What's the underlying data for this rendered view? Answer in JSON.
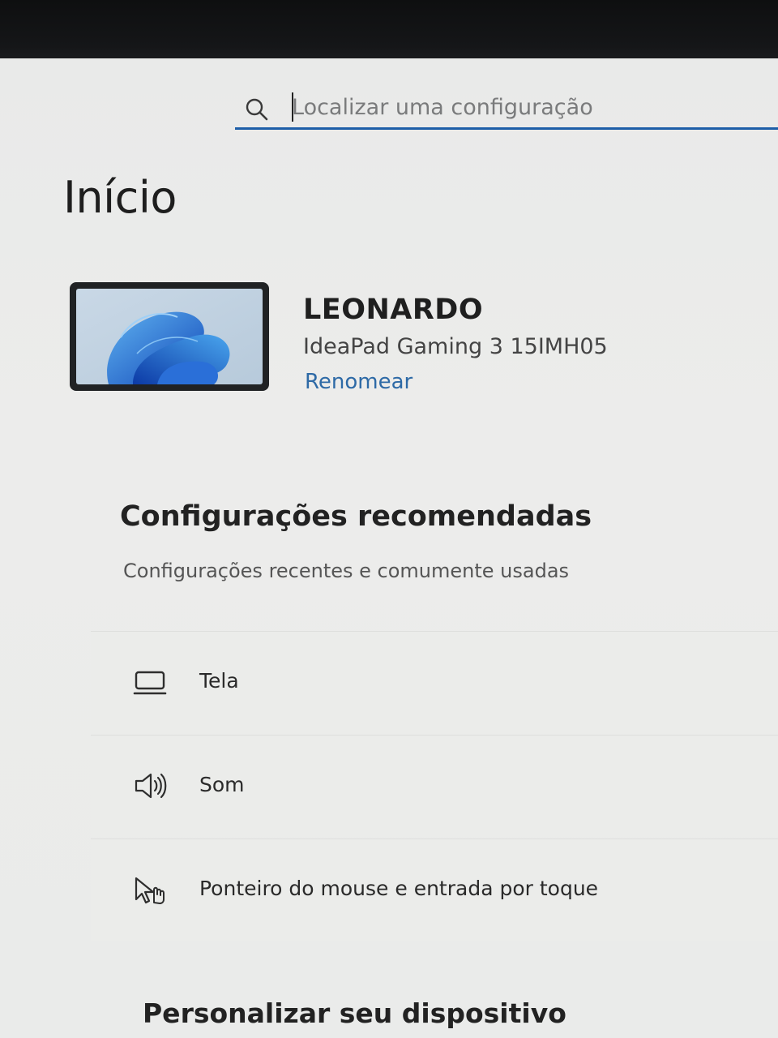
{
  "search": {
    "placeholder": "Localizar uma configuração",
    "icon": "search-icon"
  },
  "page": {
    "title": "Início"
  },
  "device": {
    "name": "LEONARDO",
    "model": "IdeaPad Gaming 3 15IMH05",
    "rename_label": "Renomear",
    "wallpaper": "windows-11-bloom"
  },
  "recommended": {
    "title": "Configurações recomendadas",
    "subtitle": "Configurações recentes e comumente usadas",
    "items": [
      {
        "label": "Tela",
        "icon": "monitor-icon"
      },
      {
        "label": "Som",
        "icon": "speaker-icon"
      },
      {
        "label": "Ponteiro do mouse e entrada por toque",
        "icon": "pointer-touch-icon"
      }
    ]
  },
  "personalize": {
    "title": "Personalizar seu dispositivo"
  },
  "colors": {
    "accent": "#1d5ea8",
    "link": "#2e6aa6",
    "background": "#ebecea"
  }
}
